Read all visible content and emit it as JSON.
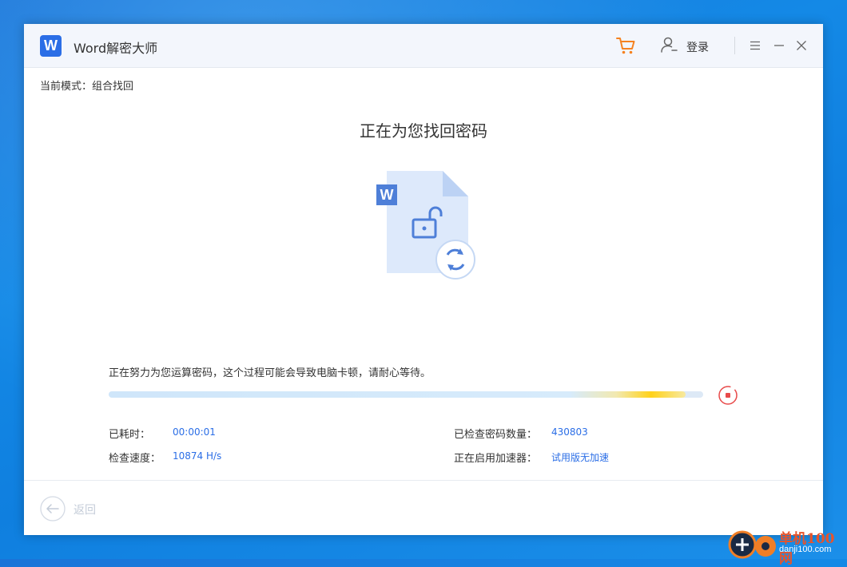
{
  "app": {
    "title": "Word解密大师",
    "logo_letter": "W"
  },
  "titlebar": {
    "login_label": "登录",
    "icons": [
      "cart-icon",
      "user-icon",
      "menu-icon",
      "minimize-icon",
      "close-icon"
    ]
  },
  "mode": {
    "text": "当前模式：组合找回"
  },
  "main": {
    "heading": "正在为您找回密码",
    "doc_badge": "W",
    "status_message": "正在努力为您运算密码，这个过程可能会导致电脑卡顿，请耐心等待。"
  },
  "progress": {
    "fraction": 0.97
  },
  "stats": {
    "elapsed_label": "已耗时：",
    "elapsed_value": "00:00:01",
    "speed_label": "检查速度：",
    "speed_value": "10874 H/s",
    "checked_label": "已检查密码数量：",
    "checked_value": "430803",
    "accel_label": "正在启用加速器：",
    "accel_value": "试用版无加速"
  },
  "footer": {
    "back_label": "返回"
  },
  "watermark": {
    "line1": "单机100网",
    "line2": "danji100.com"
  },
  "colors": {
    "accent": "#2b6ee6",
    "cart": "#f58220",
    "stop": "#e84a4a",
    "progress_highlight": "#ffd21a"
  }
}
